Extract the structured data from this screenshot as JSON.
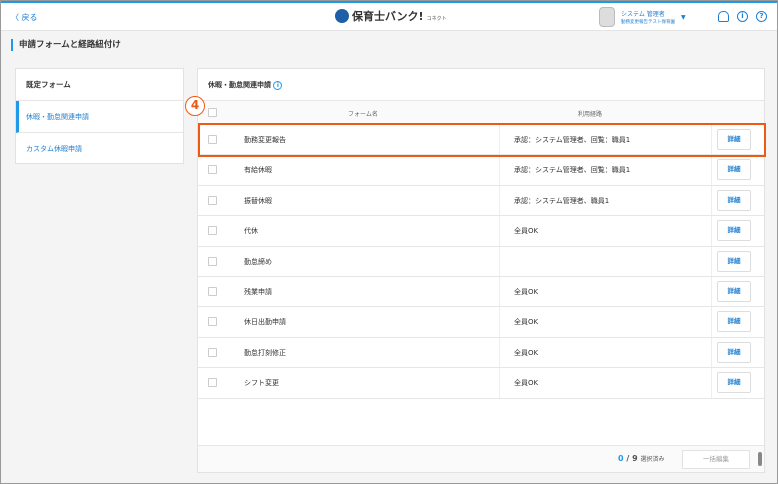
{
  "header": {
    "back": "〈 戻る",
    "logo": "保育士バンク!",
    "logo_sub": "コネクト",
    "user_name": "システム 管理者",
    "user_org": "勤務変更報告テスト保育園",
    "notify_icon": "bell-icon",
    "info_icon": "info-icon",
    "help_icon": "help-icon"
  },
  "page_title": "申請フォームと経路紐付け",
  "sidebar": {
    "heading": "既定フォーム",
    "items": [
      {
        "label": "休暇・勤怠関連申請",
        "active": true
      },
      {
        "label": "カスタム休暇申請",
        "active": false
      }
    ]
  },
  "panel": {
    "title": "休暇・勤怠関連申請",
    "columns": {
      "name": "フォーム名",
      "route": "利用経路"
    },
    "rows": [
      {
        "name": "勤務変更報告",
        "route": "承認：システム管理者、回覧：職員1",
        "button": "詳細"
      },
      {
        "name": "有給休暇",
        "route": "承認：システム管理者、回覧：職員1",
        "button": "詳細"
      },
      {
        "name": "振替休暇",
        "route": "承認：システム管理者、職員1",
        "button": "詳細"
      },
      {
        "name": "代休",
        "route": "全員OK",
        "button": "詳細"
      },
      {
        "name": "勤怠締め",
        "route": "",
        "button": "詳細"
      },
      {
        "name": "残業申請",
        "route": "全員OK",
        "button": "詳細"
      },
      {
        "name": "休日出勤申請",
        "route": "全員OK",
        "button": "詳細"
      },
      {
        "name": "勤怠打刻修正",
        "route": "全員OK",
        "button": "詳細"
      },
      {
        "name": "シフト変更",
        "route": "全員OK",
        "button": "詳細"
      }
    ]
  },
  "footer": {
    "selected": "0",
    "total": "/ 9",
    "selected_label": "選択済み",
    "bulk_edit": "一括編集"
  },
  "annotation": {
    "step": "4",
    "color": "#ee5a12"
  }
}
